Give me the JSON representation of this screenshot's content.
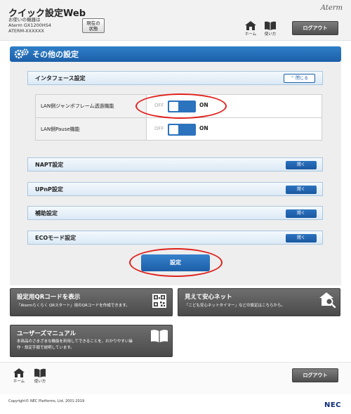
{
  "header": {
    "app_title": "クイック設定Web",
    "device_line1": "お使いの機器は",
    "device_line2": "Aterm GX1200HS4",
    "device_line3": "ATERM-XXXXXX",
    "status_line1": "現在の",
    "status_line2": "状態",
    "brand": "Aterm",
    "home_label": "ホーム",
    "manual_label": "使い方",
    "logout_label": "ログアウト"
  },
  "section": {
    "title": "その他の設定"
  },
  "interface_panel": {
    "title": "インタフェース設定",
    "close_label": "閉じる",
    "rows": [
      {
        "label": "LAN側ジャンボフレーム透過機能",
        "off": "OFF",
        "on": "ON",
        "enabled": true
      },
      {
        "label": "LAN側Pause機能",
        "off": "OFF",
        "on": "ON",
        "enabled": true
      }
    ]
  },
  "collapsed_panels": [
    {
      "title": "NAPT設定",
      "open_label": "開く"
    },
    {
      "title": "UPnP設定",
      "open_label": "開く"
    },
    {
      "title": "補助設定",
      "open_label": "開く"
    },
    {
      "title": "ECOモード設定",
      "open_label": "開く"
    }
  ],
  "apply_label": "設定",
  "cards": {
    "qr": {
      "title": "設定用QRコードを表示",
      "desc": "「Atermらくらく QRスタート」用のQRコードを作成できます。"
    },
    "safety": {
      "title": "見えて安心ネット",
      "desc": "「こども安心ネットタイマー」などの設定はこちらから。"
    },
    "manual": {
      "title": "ユーザーズマニュアル",
      "desc1": "本商品のさまざまな機能を利用してできることを、わかりやすい操",
      "desc2": "作・設定手順で説明しています。"
    }
  },
  "footer": {
    "home_label": "ホーム",
    "manual_label": "使い方",
    "logout_label": "ログアウト",
    "copyright": "Copyright© NEC Platforms, Ltd. 2001-2019",
    "brand": "NEC"
  },
  "colors": {
    "accent": "#1c5fa8",
    "highlight": "#e0201b"
  }
}
